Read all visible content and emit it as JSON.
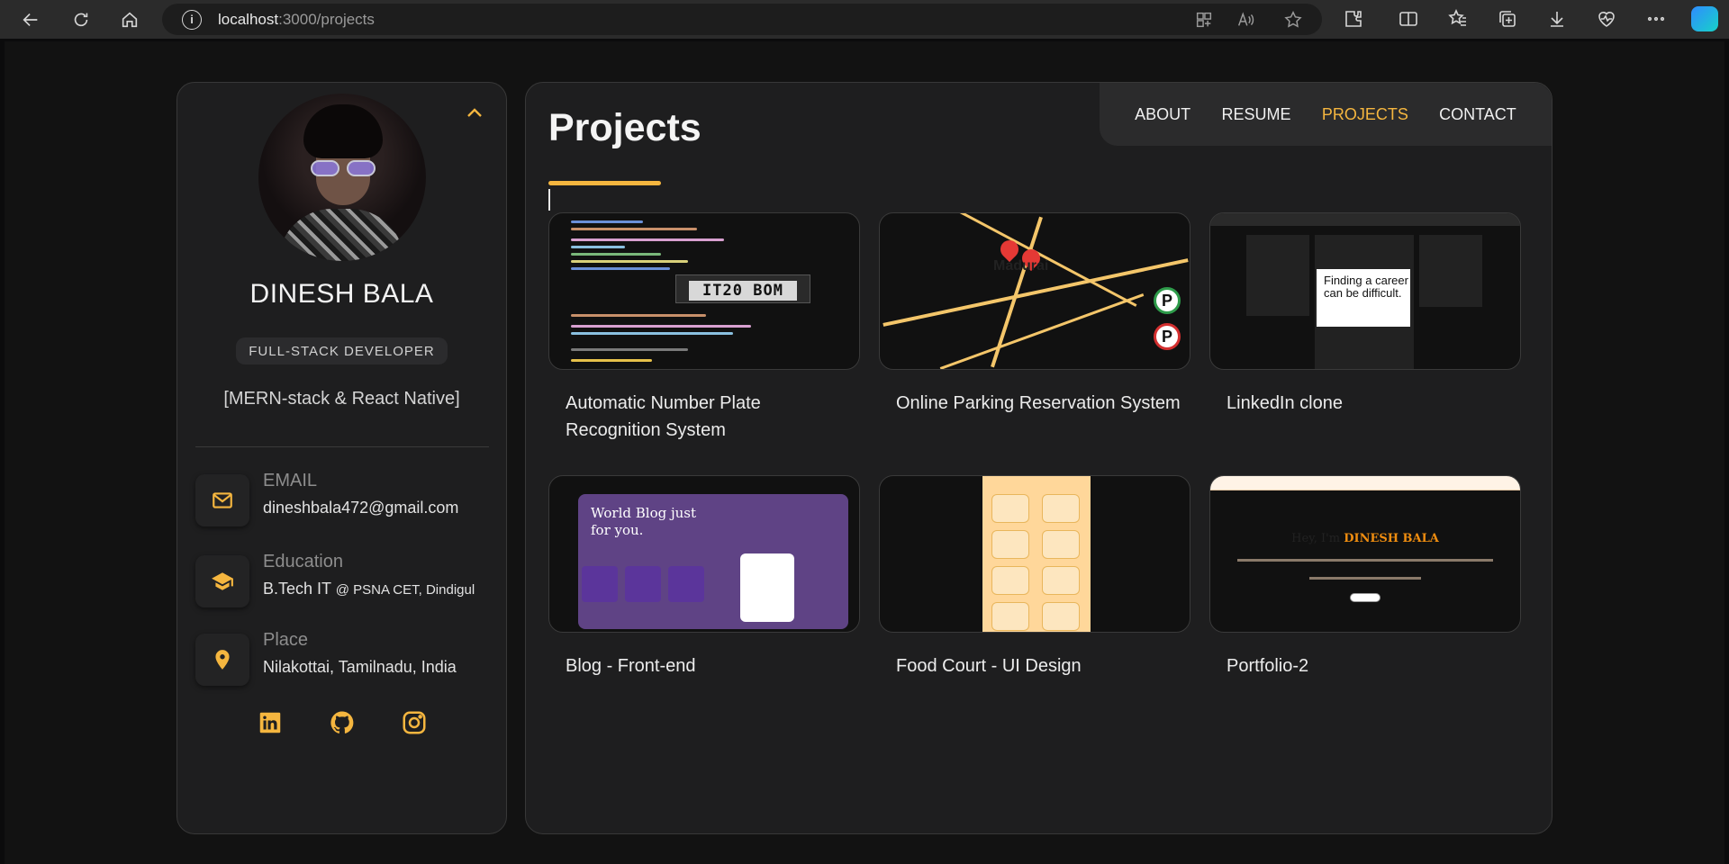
{
  "browser": {
    "url_host": "localhost",
    "url_path": ":3000/projects"
  },
  "profile": {
    "name": "DINESH BALA",
    "role": "FULL-STACK DEVELOPER",
    "stack": "[MERN-stack & React Native]"
  },
  "contacts": [
    {
      "label": "EMAIL",
      "value": "dineshbala472@gmail.com",
      "extra": ""
    },
    {
      "label": "Education",
      "value": "B.Tech IT",
      "extra": "@ PSNA CET, Dindigul"
    },
    {
      "label": "Place",
      "value": "Nilakottai, Tamilnadu, India",
      "extra": ""
    }
  ],
  "nav": {
    "about": "ABOUT",
    "resume": "RESUME",
    "projects": "PROJECTS",
    "contact": "CONTACT"
  },
  "main": {
    "title": "Projects"
  },
  "projects": [
    {
      "title": "Automatic Number Plate Recognition System",
      "thumb_text": "IT20 BOM"
    },
    {
      "title": "Online Parking Reservation System",
      "thumb_text": "Madurai"
    },
    {
      "title": "LinkedIn clone",
      "thumb_text": "Finding a career can be difficult."
    },
    {
      "title": "Blog - Front-end",
      "thumb_text": "World Blog just for you."
    },
    {
      "title": "Food Court - UI Design",
      "thumb_text": ""
    },
    {
      "title": "Portfolio-2",
      "thumb_text": "Hey, I'm",
      "thumb_name": "DINESH BALA"
    }
  ],
  "colors": {
    "accent": "#f5b63f",
    "card": "#1e1e1f",
    "page": "#121212"
  }
}
